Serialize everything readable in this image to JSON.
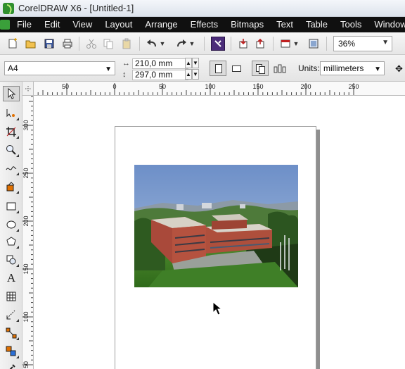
{
  "window": {
    "title": "CorelDRAW X6 - [Untitled-1]"
  },
  "menu": {
    "items": [
      "File",
      "Edit",
      "View",
      "Layout",
      "Arrange",
      "Effects",
      "Bitmaps",
      "Text",
      "Table",
      "Tools",
      "Window"
    ]
  },
  "toolbar": {
    "icons": [
      "new-document-icon",
      "open-folder-icon",
      "save-icon",
      "print-icon",
      "cut-icon",
      "copy-icon",
      "paste-icon",
      "undo-icon",
      "redo-icon",
      "search-content-icon",
      "import-icon",
      "export-icon",
      "publish-pdf-icon",
      "app-launcher-icon"
    ],
    "zoom_value": "36%"
  },
  "property_bar": {
    "page_size": "A4",
    "width": "210,0 mm",
    "height": "297,0 mm",
    "units_label": "Units:",
    "units_value": "millimeters"
  },
  "rulers": {
    "horizontal_labels": [
      "50",
      "0",
      "50",
      "100",
      "150",
      "200",
      "250"
    ],
    "vertical_labels": [
      "300",
      "250",
      "200",
      "150",
      "100",
      "50"
    ]
  },
  "toolbox": {
    "tools": [
      "pick-tool-icon",
      "shape-tool-icon",
      "crop-tool-icon",
      "zoom-tool-icon",
      "freehand-tool-icon",
      "smart-fill-tool-icon",
      "rectangle-tool-icon",
      "ellipse-tool-icon",
      "polygon-tool-icon",
      "basic-shapes-tool-icon",
      "text-tool-icon",
      "table-tool-icon",
      "dimension-tool-icon",
      "connector-tool-icon",
      "interactive-tool-icon",
      "eyedropper-tool-icon"
    ]
  },
  "colors": {
    "menubar_bg": "#101010",
    "page_shadow": "#8f8f8f"
  }
}
